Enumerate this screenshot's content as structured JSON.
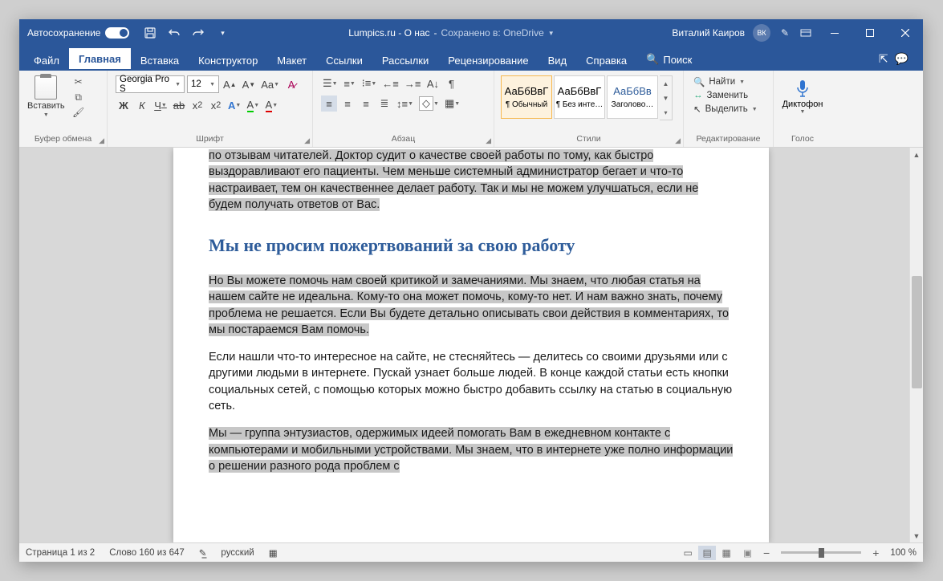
{
  "titlebar": {
    "autosave": "Автосохранение",
    "doc_title": "Lumpics.ru - О нас",
    "saved_in": "Сохранено в: OneDrive",
    "user": "Виталий Каиров",
    "user_initials": "ВК"
  },
  "tabs": {
    "file": "Файл",
    "home": "Главная",
    "insert": "Вставка",
    "design": "Конструктор",
    "layout": "Макет",
    "references": "Ссылки",
    "mailings": "Рассылки",
    "review": "Рецензирование",
    "view": "Вид",
    "help": "Справка",
    "search": "Поиск"
  },
  "ribbon": {
    "clipboard": {
      "label": "Буфер обмена",
      "paste": "Вставить"
    },
    "font": {
      "label": "Шрифт",
      "name": "Georgia Pro S",
      "size": "12"
    },
    "paragraph": {
      "label": "Абзац"
    },
    "styles": {
      "label": "Стили",
      "normal": "¶ Обычный",
      "nospacing": "¶ Без инте…",
      "heading1": "Заголово…",
      "sample": "АаБбВвГ",
      "sample_h": "АаБбВв"
    },
    "editing": {
      "label": "Редактирование",
      "find": "Найти",
      "replace": "Заменить",
      "select": "Выделить"
    },
    "voice": {
      "label": "Голос",
      "dictate": "Диктофон"
    }
  },
  "document": {
    "p1": "по отзывам читателей. Доктор судит о качестве своей работы по тому, как быстро выздоравливают его пациенты. Чем меньше системный администратор бегает и что-то настраивает, тем он качественнее делает работу. Так и мы не можем улучшаться, если не будем получать ответов от Вас.",
    "h1": "Мы не просим пожертвований за свою работу",
    "p2": "Но Вы можете помочь нам своей критикой и замечаниями. Мы знаем, что любая статья на нашем сайте не идеальна. Кому-то она может помочь, кому-то нет. И нам важно знать, почему проблема не решается. Если Вы будете детально описывать свои действия в комментариях, то мы постараемся Вам помочь.",
    "p3": "Если нашли что-то интересное на сайте, не стесняйтесь — делитесь со своими друзьями или с другими людьми в интернете. Пускай узнает больше людей. В конце каждой статьи есть кнопки социальных сетей, с помощью которых можно быстро добавить ссылку на статью в социальную сеть.",
    "p4": "Мы — группа энтузиастов, одержимых идеей помогать Вам в ежедневном контакте с компьютерами и мобильными устройствами. Мы знаем, что в интернете уже полно информации о решении разного рода проблем с"
  },
  "statusbar": {
    "page": "Страница 1 из 2",
    "words": "Слово 160 из 647",
    "lang": "русский",
    "zoom": "100 %"
  }
}
